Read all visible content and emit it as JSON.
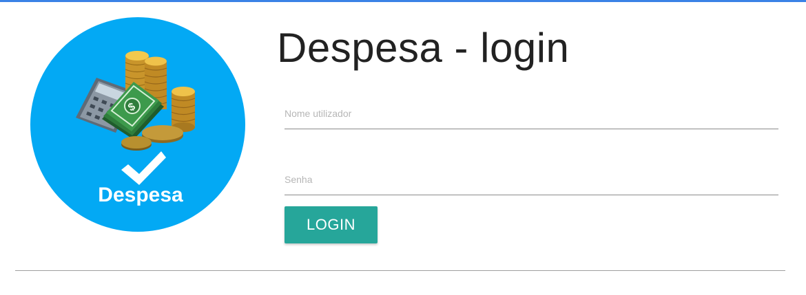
{
  "app": {
    "accent_color": "#3b82e6"
  },
  "logo": {
    "text": "Despesa",
    "background_color": "#03a9f4",
    "icons": [
      "calculator-icon",
      "banknotes-icon",
      "coin-stacks-icon",
      "checkmark-icon"
    ]
  },
  "page": {
    "title": "Despesa - login"
  },
  "form": {
    "username_placeholder": "Nome utilizador",
    "username_value": "",
    "password_placeholder": "Senha",
    "password_value": "",
    "login_label": "LOGIN",
    "button_color": "#26a69a"
  }
}
